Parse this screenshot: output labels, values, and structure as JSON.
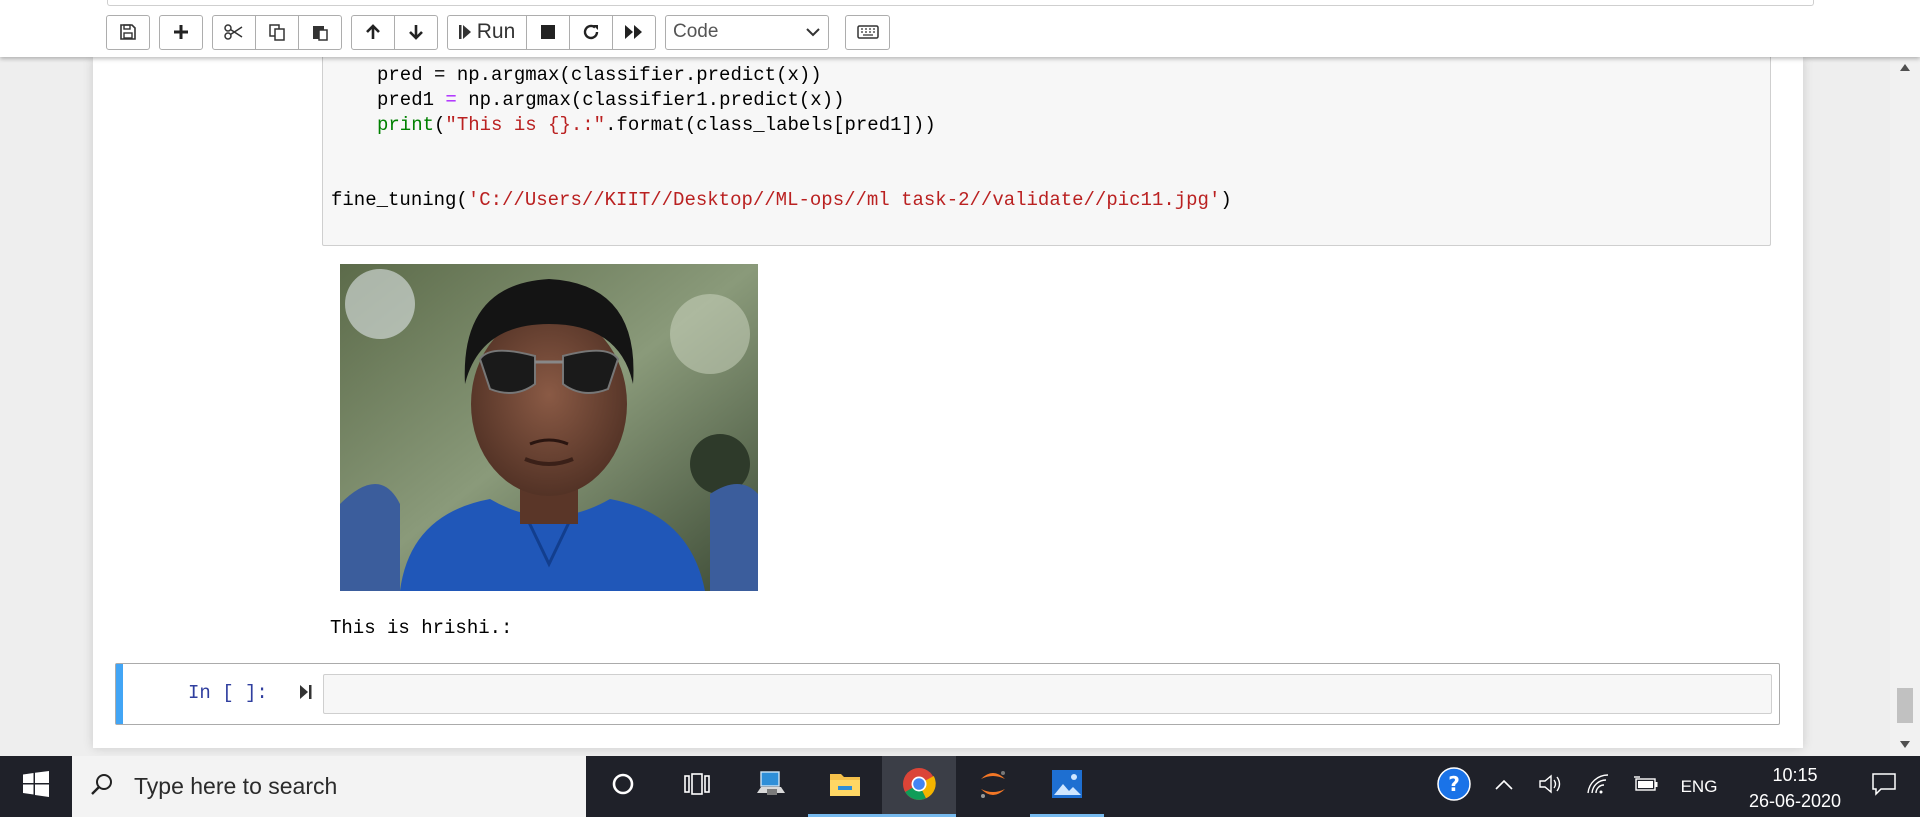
{
  "toolbar": {
    "run_label": "Run",
    "cell_type": "Code"
  },
  "code": {
    "line1": "pred = np.argmax(classifier.predict(x))",
    "line2_a": "pred1 ",
    "line2_op": "=",
    "line2_b": " np.argmax(classifier1.predict(x))",
    "line3_kw": "print",
    "line3_a": "(",
    "line3_str": "\"This is {}.:\"",
    "line3_b": ".format(class_labels[pred1]))",
    "line4_a": "fine_tuning(",
    "line4_str": "'C://Users//KIIT//Desktop//ML-ops//ml task-2//validate//pic11.jpg'",
    "line4_b": ")"
  },
  "output": {
    "text": "This is hrishi.:"
  },
  "next_cell": {
    "prompt": "In [ ]:"
  },
  "taskbar": {
    "search_placeholder": "Type here to search",
    "language": "ENG",
    "time": "10:15",
    "date": "26-06-2020"
  },
  "colors": {
    "selected_cell_bar": "#42a5f5",
    "prompt": "#303f9f",
    "string": "#ba2121",
    "keyword": "#008000",
    "operator": "#aa22ff",
    "taskbar": "#1f2129"
  }
}
